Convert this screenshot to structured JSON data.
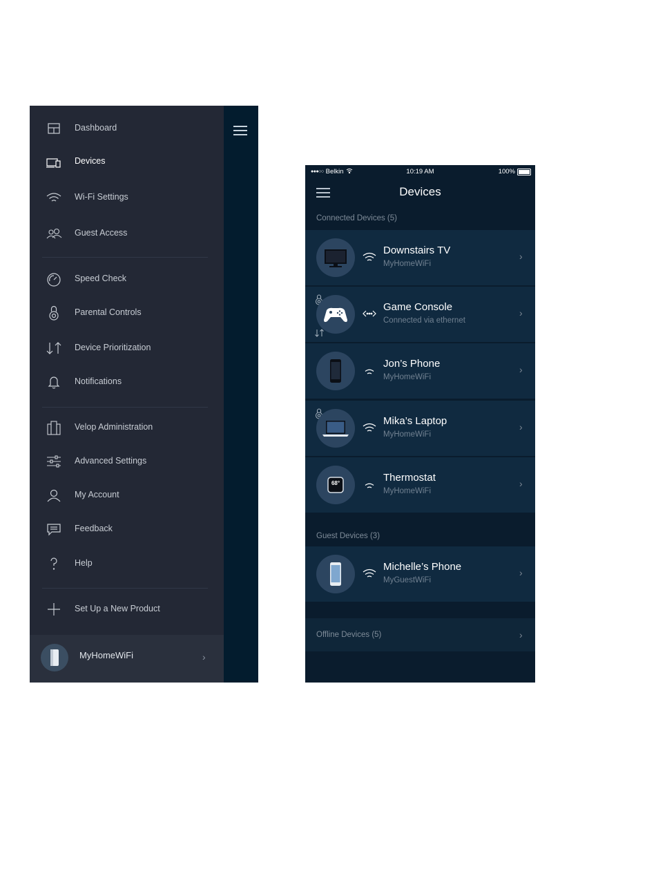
{
  "drawer": {
    "menu": [
      {
        "label": "Dashboard",
        "icon": "dashboard-icon"
      },
      {
        "label": "Devices",
        "icon": "devices-icon"
      },
      {
        "label": "Wi-Fi Settings",
        "icon": "wifi-icon"
      },
      {
        "label": "Guest Access",
        "icon": "guest-access-icon"
      },
      {
        "label": "Speed Check",
        "icon": "speedometer-icon"
      },
      {
        "label": "Parental Controls",
        "icon": "parental-controls-icon"
      },
      {
        "label": "Device Prioritization",
        "icon": "prioritization-arrows-icon"
      },
      {
        "label": "Notifications",
        "icon": "bell-icon"
      },
      {
        "label": "Velop Administration",
        "icon": "velop-nodes-icon"
      },
      {
        "label": "Advanced Settings",
        "icon": "sliders-icon"
      },
      {
        "label": "My Account",
        "icon": "person-icon"
      },
      {
        "label": "Feedback",
        "icon": "feedback-icon"
      },
      {
        "label": "Help",
        "icon": "question-icon"
      },
      {
        "label": "Set Up a New Product",
        "icon": "plus-icon"
      }
    ],
    "active_item": "Devices",
    "footer": {
      "network_name": "MyHomeWiFi",
      "chevron": "›"
    }
  },
  "screen": {
    "status_bar": {
      "signal": "●●●○○",
      "carrier": "Belkin",
      "time": "10:19 AM",
      "battery": "100%"
    },
    "title": "Devices",
    "connected_header": "Connected Devices (5)",
    "guest_header": "Guest Devices  (3)",
    "connected": [
      {
        "name": "Downstairs TV",
        "sub": "MyHomeWiFi",
        "icon": "tv-icon",
        "connection": "wifi"
      },
      {
        "name": "Game Console",
        "sub": "Connected via ethernet",
        "icon": "gamepad-icon",
        "connection": "ethernet"
      },
      {
        "name": "Jon’s Phone",
        "sub": "MyHomeWiFi",
        "icon": "phone-icon",
        "connection": "wifi"
      },
      {
        "name": "Mika’s Laptop",
        "sub": "MyHomeWiFi",
        "icon": "laptop-icon",
        "connection": "wifi"
      },
      {
        "name": "Thermostat",
        "sub": "MyHomeWiFi",
        "icon": "thermostat-icon",
        "connection": "wifi",
        "display": "68°"
      }
    ],
    "guest": [
      {
        "name": "Michelle’s Phone",
        "sub": "MyGuestWiFi",
        "icon": "phone-icon",
        "connection": "wifi"
      }
    ],
    "offline_label": "Offline Devices  (5)",
    "chevron": "›"
  },
  "colors": {
    "drawer_bg": "#232835",
    "screen_bg": "#0a1c2d",
    "row_bg": "#102a40",
    "avatar_bg": "#2c4560"
  }
}
